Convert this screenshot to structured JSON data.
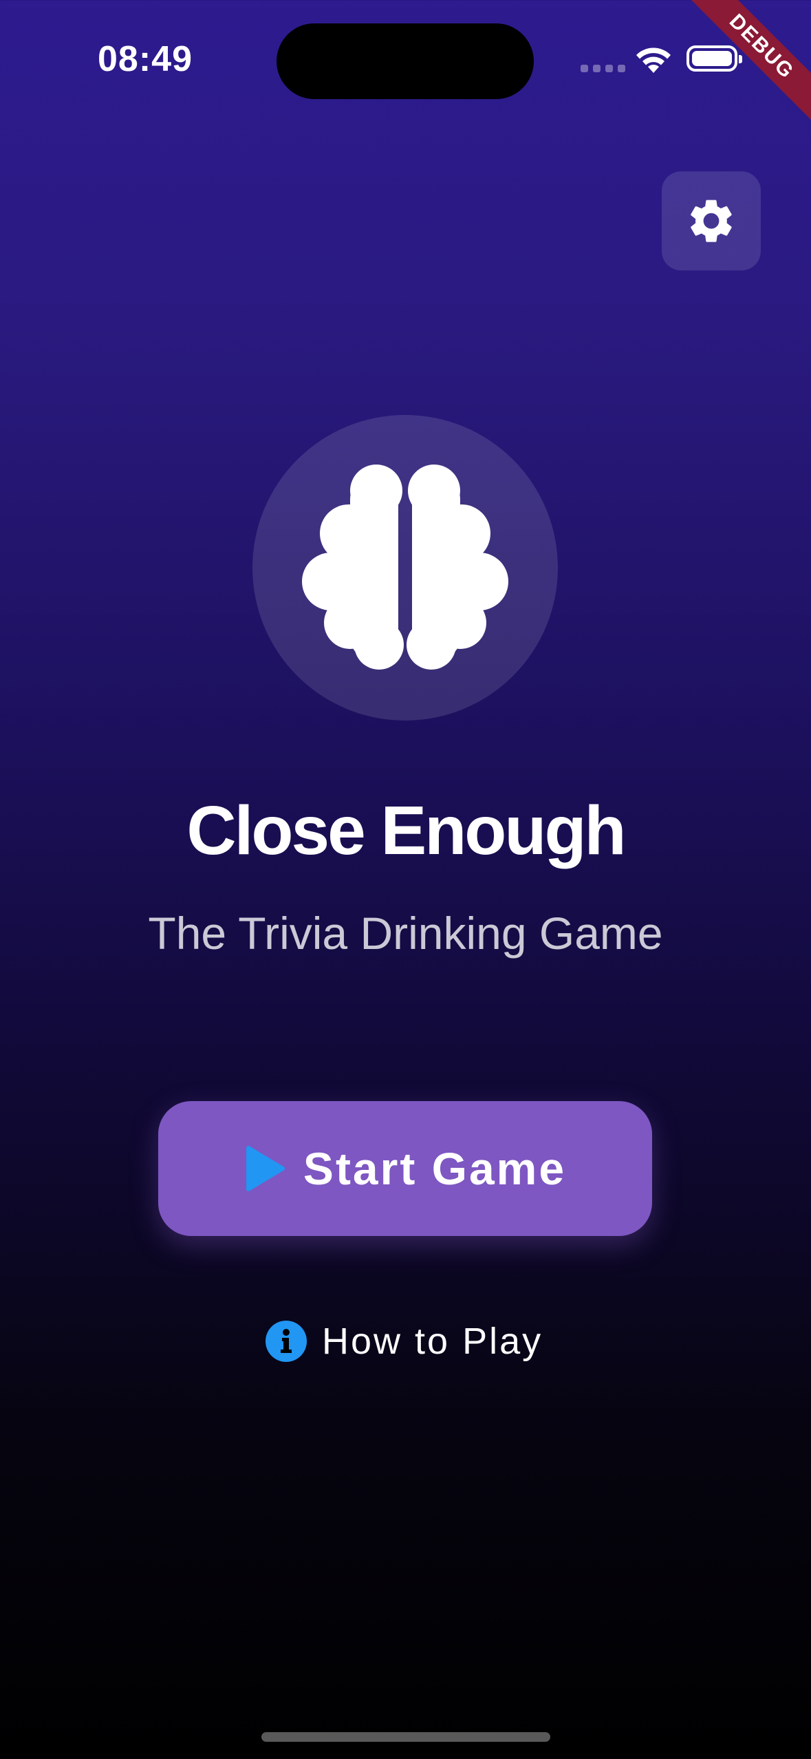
{
  "status_bar": {
    "time": "08:49"
  },
  "debug_banner": "DEBUG",
  "app": {
    "title": "Close Enough",
    "subtitle": "The Trivia Drinking Game"
  },
  "actions": {
    "start_label": "Start Game",
    "how_to_play_label": "How to Play"
  },
  "icons": {
    "settings": "gear-icon",
    "logo": "brain-icon",
    "start": "play-icon",
    "how_to_play": "info-icon"
  },
  "colors": {
    "accent_purple": "#7e57c2",
    "icon_blue": "#2196f3",
    "debug_red": "#8a1a35"
  }
}
